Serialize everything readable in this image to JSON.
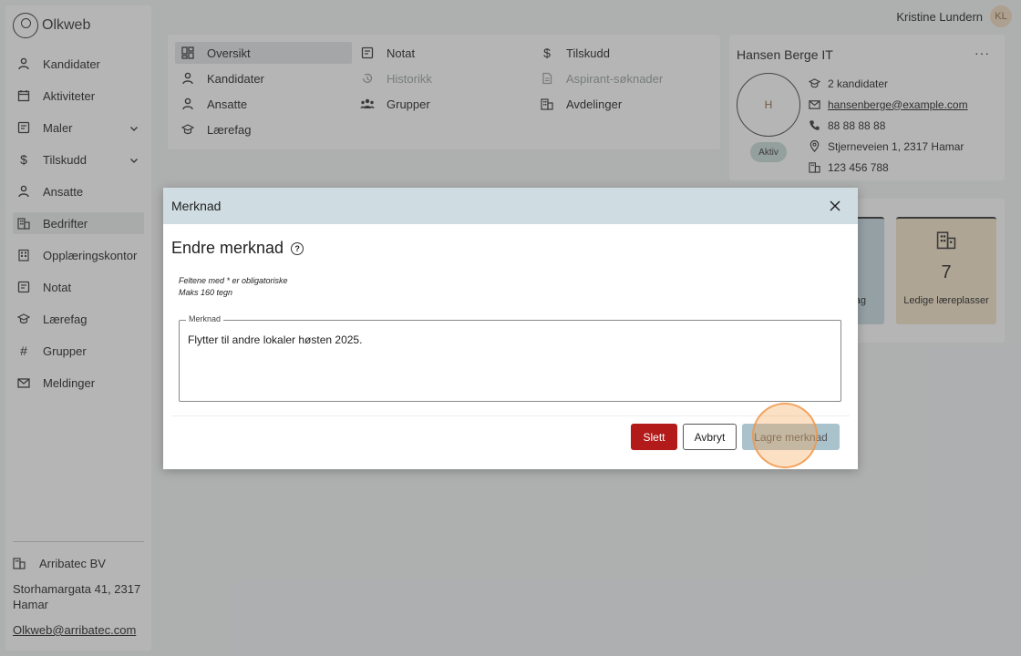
{
  "app": {
    "logo_text": "Olkweb"
  },
  "user": {
    "name": "Kristine Lundern",
    "initials": "KL"
  },
  "sidebar": {
    "items": [
      {
        "label": "Kandidater",
        "icon": "person-icon"
      },
      {
        "label": "Aktiviteter",
        "icon": "calendar-icon"
      },
      {
        "label": "Maler",
        "icon": "template-icon",
        "expandable": true
      },
      {
        "label": "Tilskudd",
        "icon": "dollar-icon",
        "expandable": true
      },
      {
        "label": "Ansatte",
        "icon": "person-icon"
      },
      {
        "label": "Bedrifter",
        "icon": "building-icon",
        "active": true
      },
      {
        "label": "Opplæringskontor",
        "icon": "office-icon"
      },
      {
        "label": "Notat",
        "icon": "note-icon"
      },
      {
        "label": "Lærefag",
        "icon": "graduation-icon"
      },
      {
        "label": "Grupper",
        "icon": "hash-icon"
      },
      {
        "label": "Meldinger",
        "icon": "mail-icon"
      }
    ],
    "org": {
      "name": "Arribatec BV",
      "address": "Storhamargata 41, 2317 Hamar",
      "email": "Olkweb@arribatec.com"
    }
  },
  "company_menu": {
    "items": [
      {
        "label": "Oversikt",
        "icon": "dashboard-icon",
        "active": true
      },
      {
        "label": "Notat",
        "icon": "note-icon"
      },
      {
        "label": "Tilskudd",
        "icon": "dollar-icon"
      },
      {
        "label": "Kandidater",
        "icon": "person-icon"
      },
      {
        "label": "Historikk",
        "icon": "history-icon",
        "disabled": true
      },
      {
        "label": "Aspirant-søknader",
        "icon": "document-icon",
        "disabled": true
      },
      {
        "label": "Ansatte",
        "icon": "person-icon"
      },
      {
        "label": "Grupper",
        "icon": "group-icon"
      },
      {
        "label": "Avdelinger",
        "icon": "building-icon"
      },
      {
        "label": "Lærefag",
        "icon": "graduation-icon"
      }
    ]
  },
  "company": {
    "name": "Hansen Berge IT",
    "more_label": "···",
    "avatar_letter": "H",
    "status": "Aktiv",
    "candidates": "2 kandidater",
    "email": "hansenberge@example.com",
    "phone": "88 88 88 88",
    "address": "Stjerneveien 1, 2317 Hamar",
    "org_number": "123 456 788"
  },
  "stats": {
    "partial_label": "ag",
    "available_count": "7",
    "available_label": "Ledige læreplasser"
  },
  "modal": {
    "header": "Merknad",
    "title": "Endre merknad",
    "help_label": "?",
    "hint_required": "Feltene med * er obligatoriske",
    "hint_max": "Maks 160 tegn",
    "field_label": "Merknad",
    "field_value": "Flytter til andre lokaler høsten 2025.",
    "delete_label": "Slett",
    "cancel_label": "Avbryt",
    "save_label": "Lagre merknad"
  },
  "colors": {
    "delete": "#b31a1a",
    "save_disabled": "#a9c2cc",
    "header_bg": "#cfdde3",
    "click_highlight": "#f5a656"
  }
}
